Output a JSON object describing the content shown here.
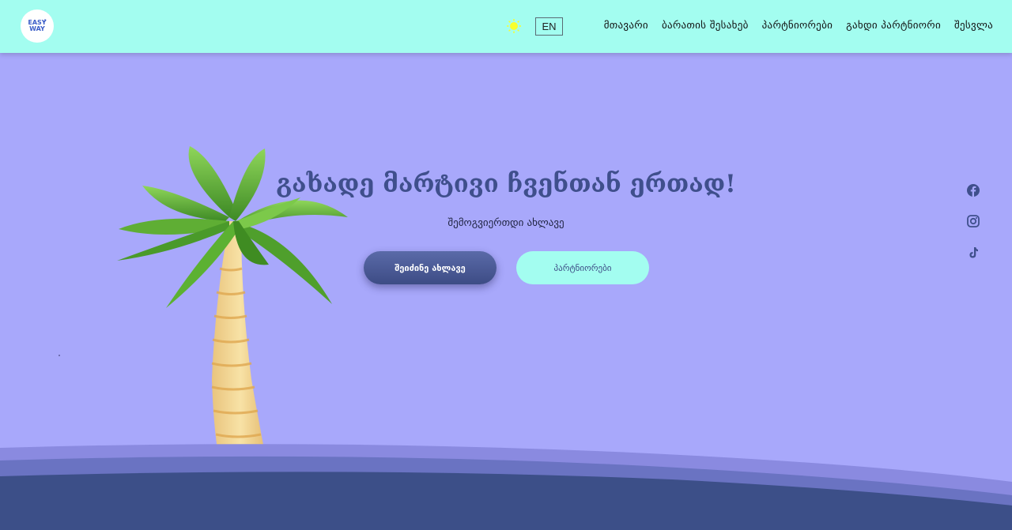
{
  "header": {
    "logo": {
      "line1": "EASY",
      "line2": "WAY"
    },
    "theme_icon": "sun-icon",
    "lang_label": "EN",
    "nav": [
      {
        "label": "მთავარი"
      },
      {
        "label": "ბარათის შესახებ"
      },
      {
        "label": "პარტნიორები"
      },
      {
        "label": "გახდი პარტნიორი"
      },
      {
        "label": "შესვლა"
      }
    ]
  },
  "hero": {
    "title": "გახადე მარტივი ჩვენთან ერთად!",
    "subtitle": "შემოგვიერთდი ახლავე",
    "primary_button": "შეიძინე ახლავე",
    "secondary_button": "პარტნიორები"
  },
  "social": [
    "facebook-icon",
    "instagram-icon",
    "tiktok-icon"
  ],
  "colors": {
    "header_bg": "#a3fdf0",
    "page_bg": "#a8a8fb",
    "primary": "#3f4f8c",
    "wave_dark": "#3c4f88"
  }
}
